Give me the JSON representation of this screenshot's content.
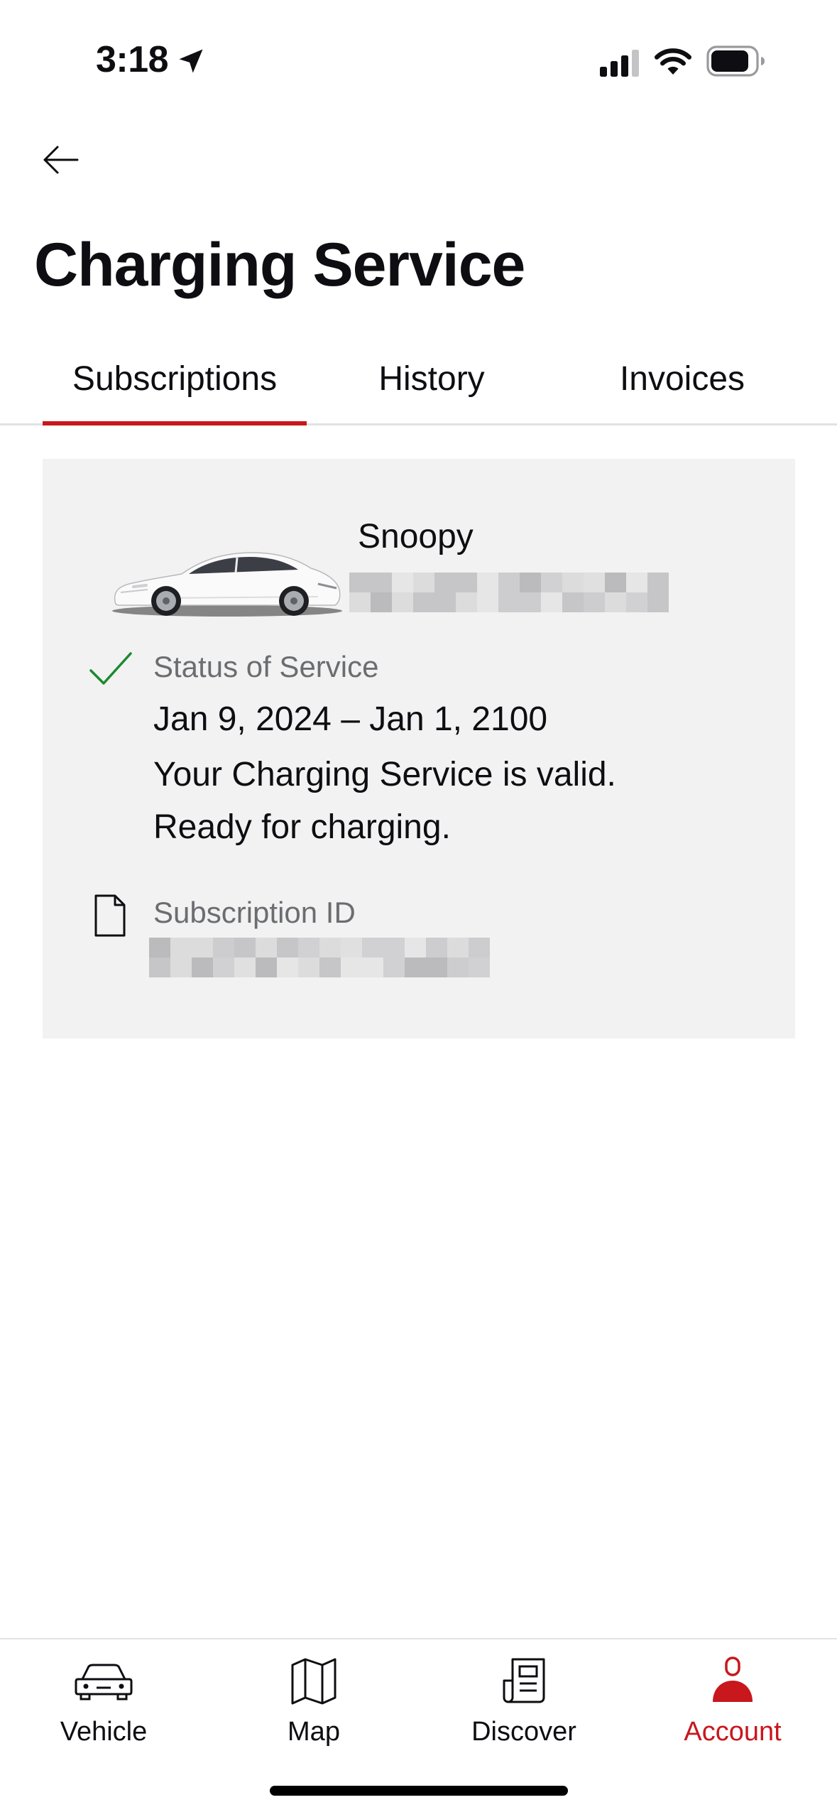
{
  "status_bar": {
    "time": "3:18",
    "icons": [
      "location-arrow-icon",
      "cellular-signal-icon",
      "wifi-icon",
      "battery-icon"
    ]
  },
  "header": {
    "back_icon": "arrow-left-icon",
    "title": "Charging Service"
  },
  "tabs": [
    {
      "label": "Subscriptions",
      "selected": true
    },
    {
      "label": "History",
      "selected": false
    },
    {
      "label": "Invoices",
      "selected": false
    }
  ],
  "subscription": {
    "vehicle_name": "Snoopy",
    "vehicle_image": "white-sedan-car-image",
    "status_icon": "checkmark-icon",
    "status_label": "Status of Service",
    "validity_period": "Jan 9, 2024 – Jan 1, 2100",
    "status_message": "Your Charging Service is valid. Ready for charging.",
    "id_icon": "document-icon",
    "subscription_id_label": "Subscription ID"
  },
  "bottom_nav": {
    "items": [
      {
        "label": "Vehicle",
        "icon": "car-icon",
        "active": false
      },
      {
        "label": "Map",
        "icon": "map-icon",
        "active": false
      },
      {
        "label": "Discover",
        "icon": "newspaper-icon",
        "active": false
      },
      {
        "label": "Account",
        "icon": "user-icon",
        "active": true
      }
    ]
  },
  "colors": {
    "accent": "#c8171d",
    "card_background": "#f2f2f2",
    "success": "#1b8a2f",
    "secondary_text": "#6b6d70",
    "text": "#0e0e12"
  }
}
